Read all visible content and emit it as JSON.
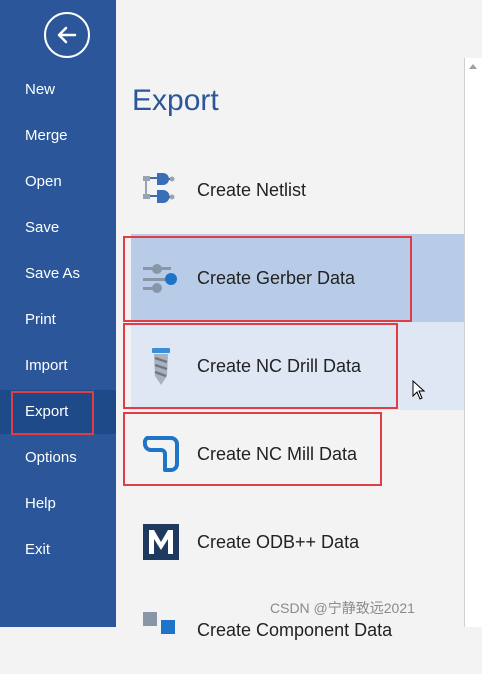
{
  "sidebar": {
    "items": [
      {
        "label": "New"
      },
      {
        "label": "Merge"
      },
      {
        "label": "Open"
      },
      {
        "label": "Save"
      },
      {
        "label": "Save As"
      },
      {
        "label": "Print"
      },
      {
        "label": "Import"
      },
      {
        "label": "Export"
      },
      {
        "label": "Options"
      },
      {
        "label": "Help"
      },
      {
        "label": "Exit"
      }
    ],
    "selected": "Export"
  },
  "main": {
    "title": "Export",
    "items": [
      {
        "label": "Create Netlist",
        "icon": "netlist-icon"
      },
      {
        "label": "Create Gerber Data",
        "icon": "gerber-icon"
      },
      {
        "label": "Create NC Drill Data",
        "icon": "drill-icon"
      },
      {
        "label": "Create NC Mill Data",
        "icon": "mill-icon"
      },
      {
        "label": "Create ODB++ Data",
        "icon": "odb-icon"
      },
      {
        "label": "Create Component Data",
        "icon": "component-icon"
      }
    ]
  },
  "watermark": "CSDN @宁静致远2021",
  "colors": {
    "sidebar": "#2b579a",
    "title": "#2b579a",
    "highlight": "#e23d45",
    "hover_row": "#b8cce8"
  }
}
